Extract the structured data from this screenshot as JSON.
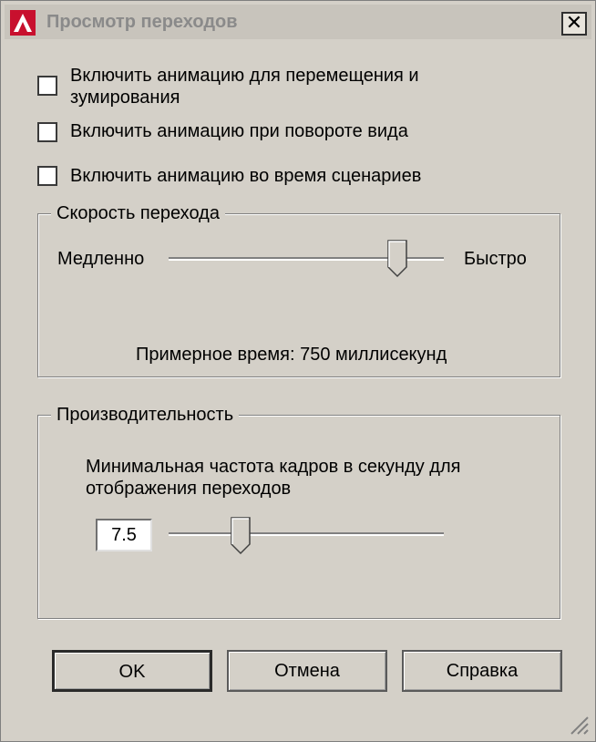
{
  "window": {
    "title": "Просмотр переходов",
    "close_glyph": "✕",
    "app_icon": "autocad-logo-icon",
    "close_icon": "close-icon"
  },
  "options": [
    {
      "label": "Включить анимацию для перемещения и зумирования",
      "checked": false
    },
    {
      "label": "Включить анимацию при повороте вида",
      "checked": false
    },
    {
      "label": "Включить анимацию во время сценариев",
      "checked": false
    }
  ],
  "speed": {
    "title": "Скорость перехода",
    "slow_label": "Медленно",
    "fast_label": "Быстро",
    "approx_time_text": "Примерное время: 750 миллисекунд",
    "slider_fraction": 0.83
  },
  "performance": {
    "title": "Производительность",
    "description": "Минимальная частота кадров в секунду для отображения переходов",
    "fps_value": "7.5",
    "slider_fraction": 0.26
  },
  "buttons": {
    "ok": "OK",
    "cancel": "Отмена",
    "help": "Справка"
  },
  "colors": {
    "dialog_bg": "#d4d0c8",
    "icon_red": "#c8102e"
  }
}
